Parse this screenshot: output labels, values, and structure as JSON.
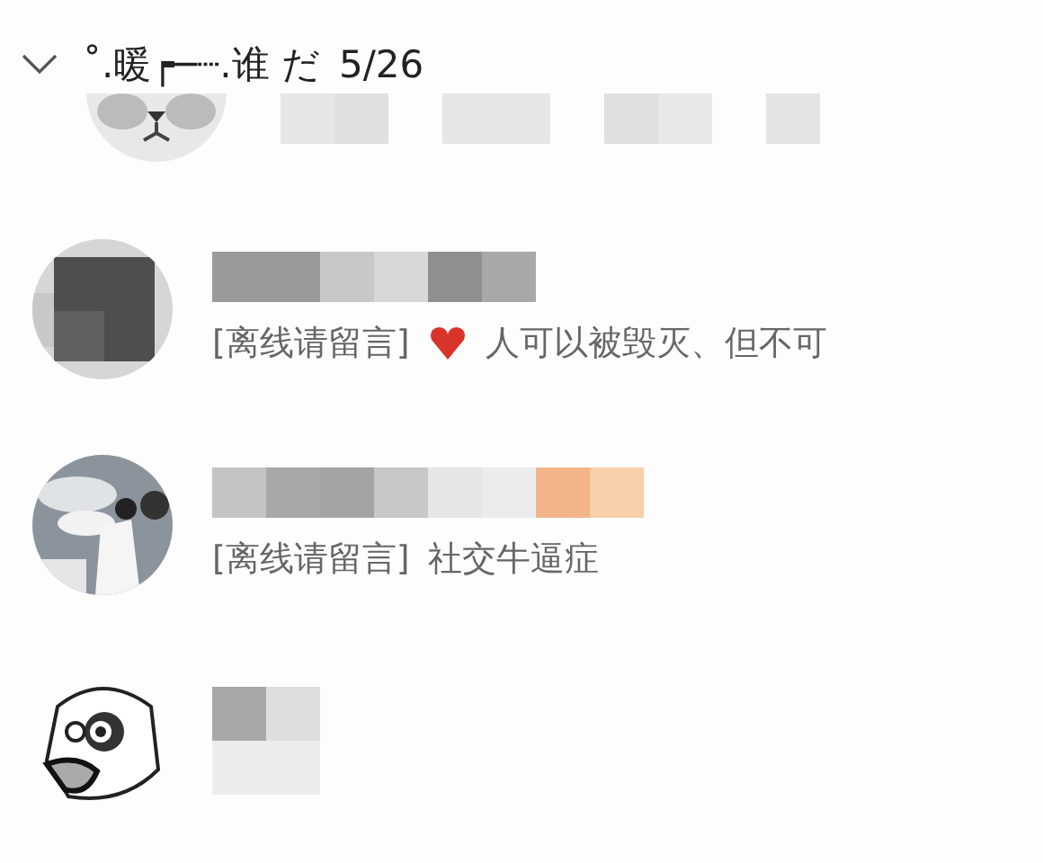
{
  "group": {
    "title": "˚.暖┍─┈.谁 だ",
    "count": "5/26",
    "expanded": true
  },
  "friends": [
    {
      "kind": "cat"
    },
    {
      "kind": "mosaic",
      "status": "[离线请留言]",
      "heart": true,
      "signature": "人可以被毁灭、但不可"
    },
    {
      "status": "[离线请留言]",
      "signature": "社交牛逼症"
    },
    {
      "kind": "cartoon"
    }
  ]
}
